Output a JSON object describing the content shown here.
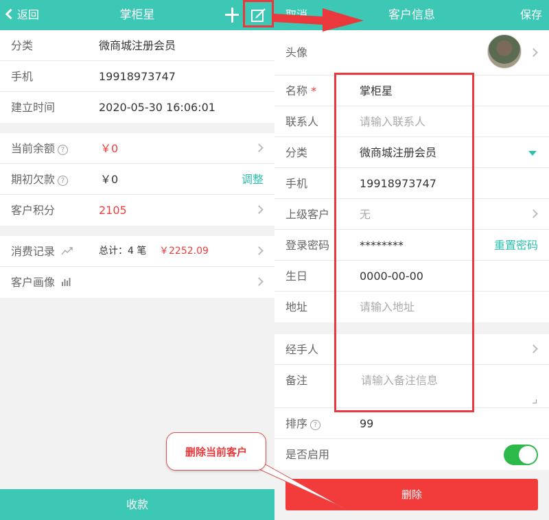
{
  "left": {
    "header": {
      "back_label": "返回",
      "title": "掌柜星"
    },
    "info": [
      {
        "label": "分类",
        "value": "微商城注册会员"
      },
      {
        "label": "手机",
        "value": "19918973747"
      },
      {
        "label": "建立时间",
        "value": "2020-05-30 16:06:01"
      }
    ],
    "balance": {
      "current_label": "当前余额",
      "current_value": "￥0",
      "debt_label": "期初欠款",
      "debt_value": "￥0",
      "adjust_label": "调整",
      "points_label": "客户积分",
      "points_value": "2105"
    },
    "records": {
      "consume_label": "消费记录",
      "consume_total": "总计：4 笔",
      "consume_amount": "￥2252.09",
      "profile_label": "客户画像"
    },
    "collect_button": "收款"
  },
  "right": {
    "header": {
      "cancel_label": "取消",
      "title": "客户信息",
      "save_label": "保存"
    },
    "avatar_label": "头像",
    "form": {
      "name_label": "名称",
      "name_value": "掌柜星",
      "required_mark": "*",
      "contact_label": "联系人",
      "contact_placeholder": "请输入联系人",
      "category_label": "分类",
      "category_value": "微商城注册会员",
      "phone_label": "手机",
      "phone_value": "19918973747",
      "parent_label": "上级客户",
      "parent_value": "无",
      "password_label": "登录密码",
      "password_value": "********",
      "reset_password": "重置密码",
      "birthday_label": "生日",
      "birthday_value": "0000-00-00",
      "address_label": "地址",
      "address_placeholder": "请输入地址"
    },
    "extra": {
      "handler_label": "经手人",
      "note_label": "备注",
      "note_placeholder": "请输入备注信息",
      "sort_label": "排序",
      "sort_value": "99",
      "enabled_label": "是否启用",
      "enabled": true
    },
    "delete_button": "删除"
  },
  "annotation": {
    "callout_text": "删除当前客户",
    "accent_color": "#e9393c"
  },
  "colors": {
    "teal": "#3cc8b4",
    "red": "#f23c3c",
    "toggle_green": "#2db84a"
  }
}
